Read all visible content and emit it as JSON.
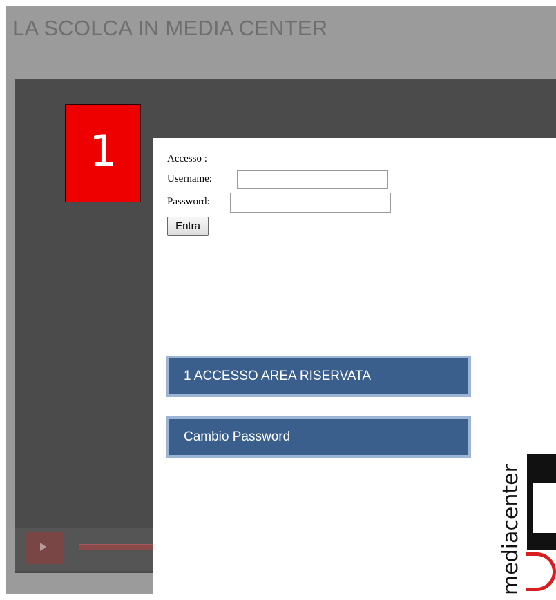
{
  "site": {
    "title": "LA SCOLCA IN MEDIA CENTER"
  },
  "step_badge": {
    "number": "1"
  },
  "login": {
    "heading": "Accesso :",
    "username_label": "Username:",
    "username_value": "",
    "password_label": "Password:",
    "password_value": "",
    "submit_label": "Entra"
  },
  "callouts": [
    {
      "label": "1 ACCESSO AREA RISERVATA"
    },
    {
      "label": "Cambio Password"
    }
  ],
  "logo": {
    "text": "mediacenter"
  },
  "colors": {
    "badge_red": "#ee0000",
    "callout_blue": "#3a5f8d",
    "callout_border": "#9db5d4",
    "logo_red": "#d81e1e"
  },
  "icons": {
    "play": "play-icon"
  }
}
